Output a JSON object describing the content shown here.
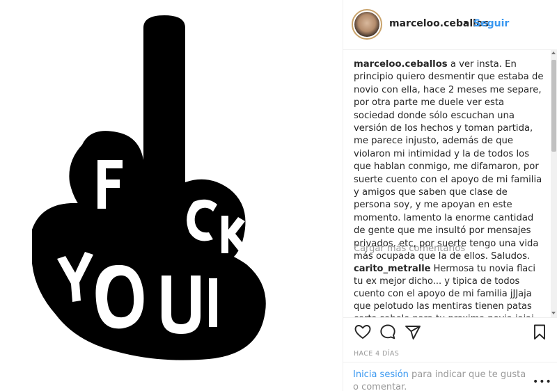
{
  "post": {
    "username": "marceloo.ceballos",
    "separator": "•",
    "follow_label": "Seguir",
    "caption_user": "marceloo.ceballos",
    "caption_text": "a ver insta. En principio quiero desmentir que estaba de novio con ella, hace 2 meses me separe, por otra parte me duele ver esta sociedad donde sólo escuchan una versión de los hechos y toman partida, me parece injusto, además de que violaron mi intimidad y la de todos los que hablan conmigo, me difamaron, por suerte cuento con el apoyo de mi familia y amigos que saben que clase de persona soy, y me apoyan en este momento. lamento la enorme cantidad de gente que me insultó por mensajes privados, etc, por suerte tengo una vida más ocupada que la de ellos. Saludos.",
    "load_more": "Cargar más comentarios",
    "comment_user": "carito_metralle",
    "comment_text": "Hermosa tu novia flaci tu ex mejor dicho... y tipica de todos cuento con el apoyo de mi familia jJJaja que pelotudo las mentiras tienen patas corta sabelo para tu proxima novia jajaj",
    "timestamp": "HACE 4 DÍAS",
    "login_link": "Inicia sesión",
    "login_rest": "para indicar que te gusta o comentar.",
    "more_label": "•••"
  },
  "image": {
    "letters": [
      "F",
      "U",
      "C",
      "K",
      "Y",
      "O",
      "U"
    ],
    "fill_color": "#000000"
  },
  "icons": {
    "like": "heart-icon",
    "comment": "comment-icon",
    "share": "share-icon",
    "save": "bookmark-icon"
  },
  "colors": {
    "link_blue": "#3897f0",
    "muted_gray": "#999999",
    "text": "#262626"
  }
}
